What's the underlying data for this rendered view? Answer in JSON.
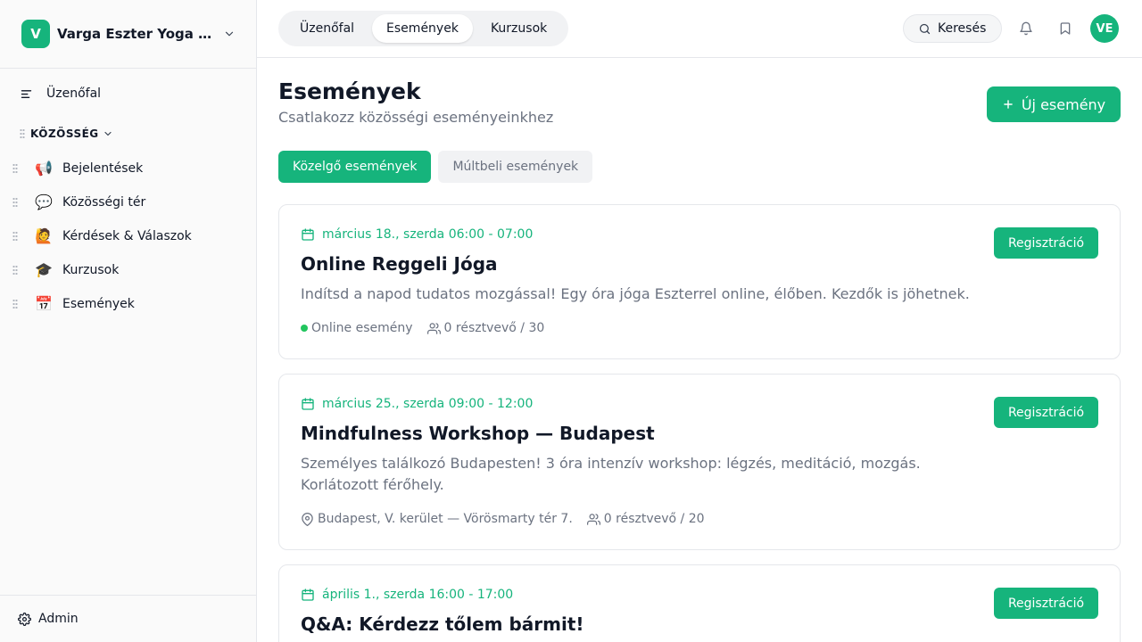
{
  "sidebar": {
    "community": {
      "initial": "V",
      "name": "Varga Eszter Yoga & Mindfulness"
    },
    "feed_label": "Üzenőfal",
    "section_label": "KÖZÖSSÉG",
    "items": [
      {
        "emoji": "📢",
        "label": "Bejelentések"
      },
      {
        "emoji": "💬",
        "label": "Közösségi tér"
      },
      {
        "emoji": "🙋",
        "label": "Kérdések & Válaszok"
      },
      {
        "emoji": "🎓",
        "label": "Kurzusok"
      },
      {
        "emoji": "📅",
        "label": "Események"
      }
    ],
    "admin_label": "Admin"
  },
  "topbar": {
    "tabs": [
      {
        "label": "Üzenőfal",
        "active": false
      },
      {
        "label": "Események",
        "active": true
      },
      {
        "label": "Kurzusok",
        "active": false
      }
    ],
    "search_label": "Keresés",
    "avatar_initials": "VE"
  },
  "main": {
    "title": "Események",
    "subtitle": "Csatlakozz közösségi eseményeinkhez",
    "new_button_label": "Új esemény",
    "filters": [
      {
        "label": "Közelgő események",
        "active": true
      },
      {
        "label": "Múltbeli események",
        "active": false
      }
    ],
    "events": [
      {
        "date": "március 18., szerda 06:00 - 07:00",
        "title": "Online Reggeli Jóga",
        "description": "Indítsd a napod tudatos mozgással! Egy óra jóga Eszterrel online, élőben. Kezdők is jöhetnek.",
        "location": "Online esemény",
        "location_type": "online",
        "attendees": "0 résztvevő / 30",
        "button_label": "Regisztráció"
      },
      {
        "date": "március 25., szerda 09:00 - 12:00",
        "title": "Mindfulness Workshop — Budapest",
        "description": "Személyes találkozó Budapesten! 3 óra intenzív workshop: légzés, meditáció, mozgás. Korlátozott férőhely.",
        "location": "Budapest, V. kerület — Vörösmarty tér 7.",
        "location_type": "in-person",
        "attendees": "0 résztvevő / 20",
        "button_label": "Regisztráció"
      },
      {
        "date": "április 1., szerda 16:00 - 17:00",
        "title": "Q&A: Kérdezz tőlem bármit!",
        "button_label": "Regisztráció"
      }
    ]
  },
  "colors": {
    "accent": "#16b47c",
    "online_dot": "#22c55e",
    "muted_text": "#6b7280",
    "border": "#e5e7eb"
  }
}
